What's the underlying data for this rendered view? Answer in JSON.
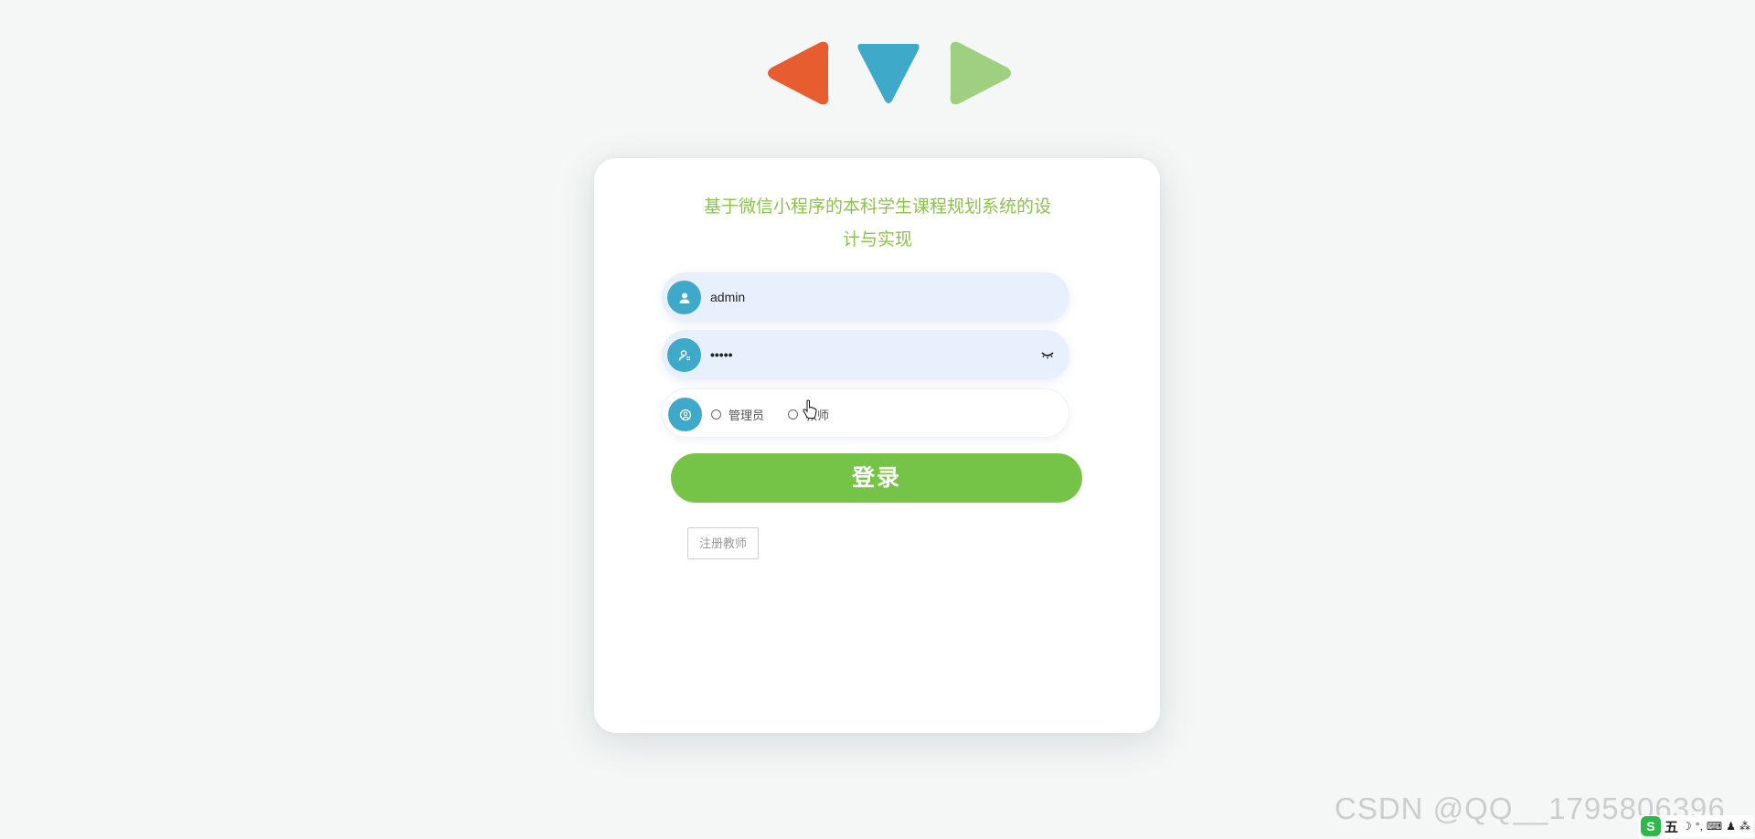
{
  "title_line1": "基于微信小程序的本科学生课程规划系统的设",
  "title_line2": "计与实现",
  "username": {
    "value": "admin",
    "icon": "user-icon"
  },
  "password": {
    "masked_value": "•••••",
    "icon": "password-icon",
    "toggle_icon": "eye-closed-icon"
  },
  "role": {
    "icon": "role-icon",
    "options": [
      "管理员",
      "教师"
    ]
  },
  "login_button": "登录",
  "register_button": "注册教师",
  "watermark": "CSDN @QQ__1795806396",
  "ime": {
    "logo": "S",
    "mode": "五"
  },
  "colors": {
    "background": "#f5f6f6",
    "accent_green": "#76c447",
    "title_green": "#8bc34a",
    "icon_blue": "#3fa9c9",
    "arrow_orange": "#e85d2f",
    "arrow_blue": "#3fa9c9",
    "arrow_green": "#9ed080"
  }
}
